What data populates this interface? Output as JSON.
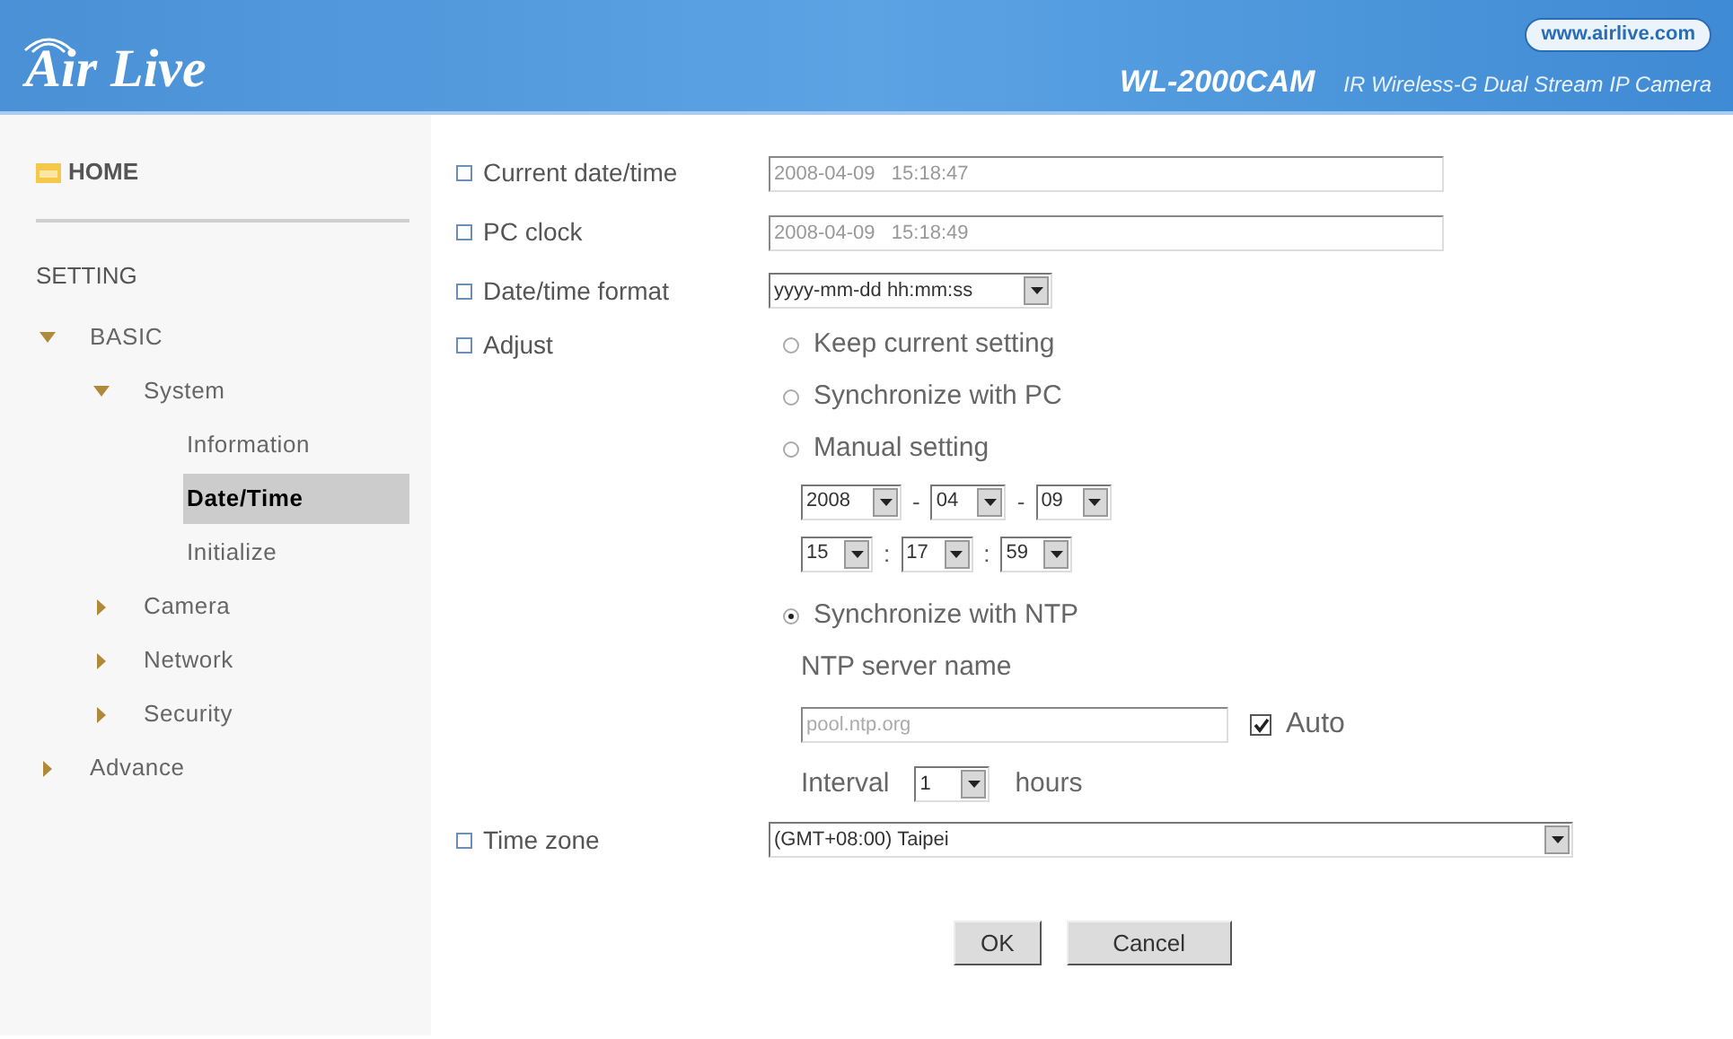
{
  "header": {
    "logo": "Air Live",
    "website": "www.airlive.com",
    "model": "WL-2000CAM",
    "product": "IR Wireless-G Dual Stream IP Camera"
  },
  "sidebar": {
    "home": "HOME",
    "section": "SETTING",
    "tree": [
      {
        "label": "BASIC",
        "expanded": true,
        "selected": false,
        "children": [
          {
            "label": "System",
            "expanded": true,
            "selected": false,
            "children": [
              {
                "label": "Information",
                "selected": false
              },
              {
                "label": "Date/Time",
                "selected": true
              },
              {
                "label": "Initialize",
                "selected": false
              }
            ]
          },
          {
            "label": "Camera",
            "expanded": false,
            "selected": false
          },
          {
            "label": "Network",
            "expanded": false,
            "selected": false
          },
          {
            "label": "Security",
            "expanded": false,
            "selected": false
          }
        ]
      },
      {
        "label": "Advance",
        "expanded": false,
        "selected": false
      }
    ]
  },
  "form": {
    "current_datetime": {
      "label": "Current date/time",
      "value": "2008-04-09   15:18:47"
    },
    "pc_clock": {
      "label": "PC clock",
      "value": "2008-04-09   15:18:49"
    },
    "format": {
      "label": "Date/time format",
      "value": "yyyy-mm-dd hh:mm:ss"
    },
    "adjust": {
      "label": "Adjust",
      "options": [
        {
          "label": "Keep current setting",
          "selected": false
        },
        {
          "label": "Synchronize with PC",
          "selected": false
        },
        {
          "label": "Manual setting",
          "selected": false
        },
        {
          "label": "Synchronize with NTP",
          "selected": true
        }
      ],
      "date": [
        "2008",
        "04",
        "09"
      ],
      "date_separator": "-",
      "time": [
        "15",
        "17",
        "59"
      ],
      "time_separator": ":",
      "ntp_label": "NTP server name",
      "ntp_server": "pool.ntp.org",
      "auto": {
        "label": "Auto",
        "checked": true
      },
      "interval_label": "Interval",
      "interval": "1",
      "interval_unit": "hours"
    },
    "time_zone": {
      "label": "Time zone",
      "value": "(GMT+08:00) Taipei"
    }
  },
  "buttons": [
    "OK",
    "Cancel"
  ]
}
